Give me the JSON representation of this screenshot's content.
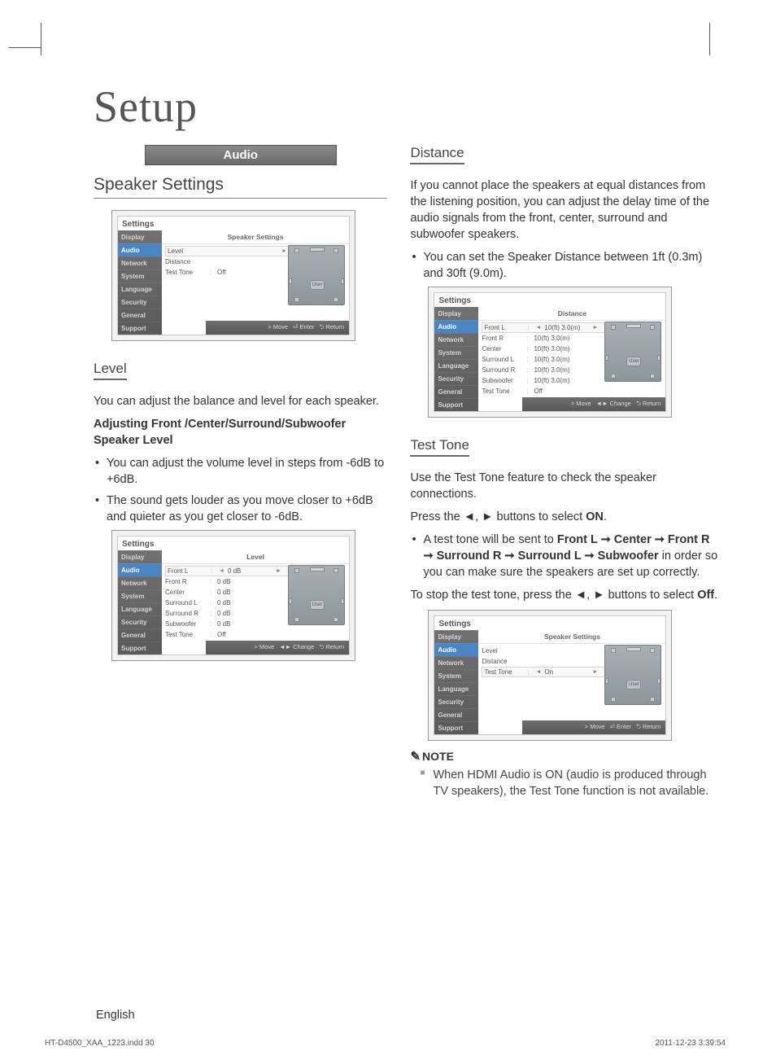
{
  "title": "Setup",
  "footer": {
    "lang": "English",
    "file": "HT-D4500_XAA_1223.indd   30",
    "date": "2011-12-23   3:39:54"
  },
  "bar": {
    "label": "Audio"
  },
  "left": {
    "heading": "Speaker Settings",
    "level": {
      "heading": "Level",
      "intro": "You can adjust the balance and level for each speaker.",
      "subhead": "Adjusting Front /Center/Surround/Subwoofer Speaker Level",
      "b1": "You can adjust the volume level in steps from -6dB to +6dB.",
      "b2": "The sound gets louder as you move closer to +6dB and quieter as you get closer to -6dB."
    }
  },
  "right": {
    "distance": {
      "heading": "Distance",
      "p1": "If you cannot place the speakers at equal distances from the listening position, you can adjust the delay time of the audio signals from the front, center, surround and subwoofer speakers.",
      "b1": "You can set the Speaker Distance between 1ft (0.3m) and 30ft (9.0m)."
    },
    "testtone": {
      "heading": "Test Tone",
      "p1": "Use the Test Tone feature to check the speaker connections.",
      "p2a": "Press the ◄, ► buttons to select ",
      "p2b": "ON",
      "p2c": ".",
      "b1a": "A test tone will be sent to ",
      "b1b": "Front L ➞ Center ➞ Front R ➞ Surround R ➞ Surround L ➞ Subwoofer",
      "b1c": " in order so you can make sure the speakers are set up correctly.",
      "p3a": "To stop the test tone, press the ◄, ► buttons to select ",
      "p3b": "Off",
      "p3c": "."
    },
    "note": {
      "head": "NOTE",
      "n1": "When HDMI Audio is ON (audio is produced through TV speakers), the Test Tone function is not available."
    }
  },
  "ui_common": {
    "settings": "Settings",
    "side": [
      "Display",
      "Audio",
      "Network",
      "System",
      "Language",
      "Security",
      "General",
      "Support"
    ],
    "foot_move": "> Move",
    "foot_enter": "⏎ Enter",
    "foot_change": "◄► Change",
    "foot_return": "⮌ Return",
    "user": "User"
  },
  "ui1": {
    "header": "Speaker Settings",
    "rows": [
      {
        "label": "Level",
        "sel": true,
        "arrow": "►"
      },
      {
        "label": "Distance"
      },
      {
        "label": "Test Tone",
        "colon": ":",
        "value": "Off"
      }
    ]
  },
  "ui2": {
    "header": "Level",
    "rows": [
      {
        "label": "Front L",
        "colon": ":",
        "value": "0 dB",
        "sel": true,
        "arrows": true
      },
      {
        "label": "Front R",
        "colon": ":",
        "value": "0 dB"
      },
      {
        "label": "Center",
        "colon": ":",
        "value": "0 dB"
      },
      {
        "label": "Surround L",
        "colon": ":",
        "value": "0 dB"
      },
      {
        "label": "Surround R",
        "colon": ":",
        "value": "0 dB"
      },
      {
        "label": "Subwoofer",
        "colon": ":",
        "value": "0 dB"
      },
      {
        "label": "Test Tone",
        "colon": ":",
        "value": "Off"
      }
    ]
  },
  "ui3": {
    "header": "Distance",
    "rows": [
      {
        "label": "Front L",
        "colon": ":",
        "value": "10(ft) 3.0(m)",
        "sel": true,
        "arrows": true
      },
      {
        "label": "Front R",
        "colon": ":",
        "value": "10(ft) 3.0(m)"
      },
      {
        "label": "Center",
        "colon": ":",
        "value": "10(ft) 3.0(m)"
      },
      {
        "label": "Surround L",
        "colon": ":",
        "value": "10(ft) 3.0(m)"
      },
      {
        "label": "Surround R",
        "colon": ":",
        "value": "10(ft) 3.0(m)"
      },
      {
        "label": "Subwoofer",
        "colon": ":",
        "value": "10(ft) 3.0(m)"
      },
      {
        "label": "Test Tone",
        "colon": ":",
        "value": "Off"
      }
    ]
  },
  "ui4": {
    "header": "Speaker Settings",
    "rows": [
      {
        "label": "Level"
      },
      {
        "label": "Distance"
      },
      {
        "label": "Test Tone",
        "colon": ":",
        "value": "On",
        "sel": true,
        "arrows": true
      }
    ]
  }
}
